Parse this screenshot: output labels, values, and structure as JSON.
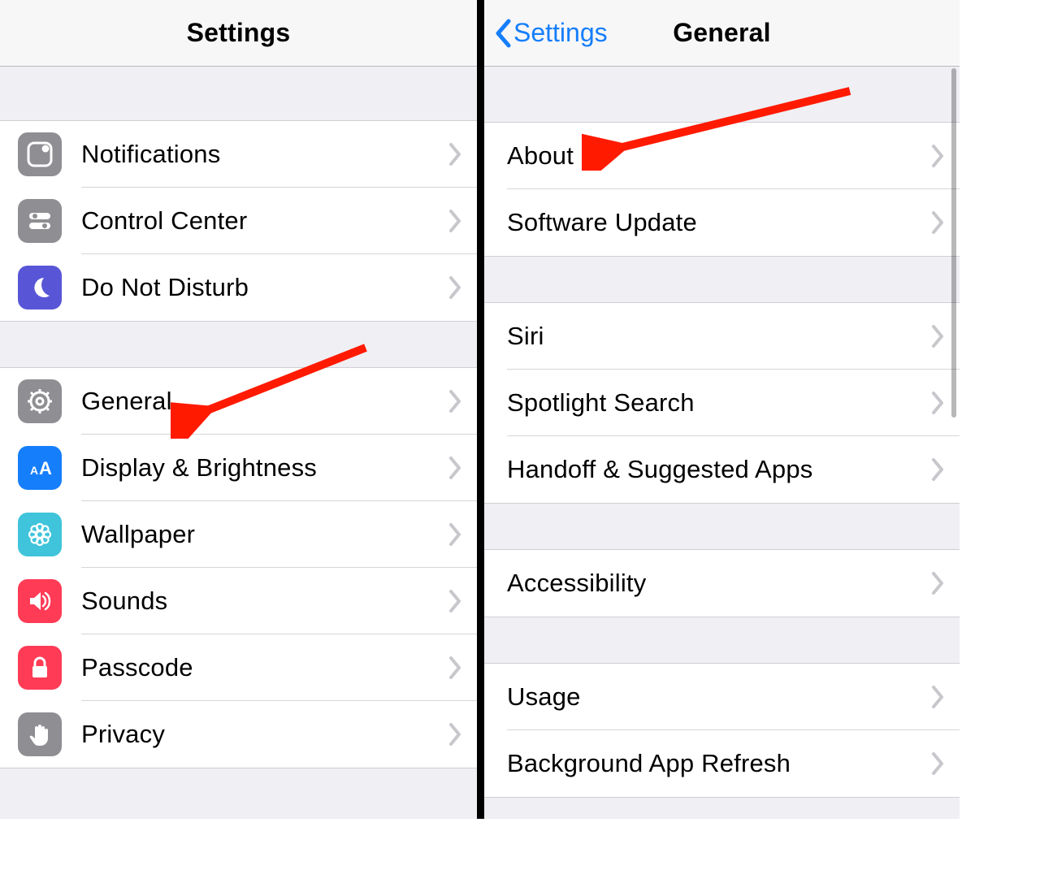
{
  "left": {
    "title": "Settings",
    "groups": [
      [
        {
          "id": "notifications",
          "label": "Notifications",
          "iconClass": "ic-notif",
          "iconName": "notifications-icon"
        },
        {
          "id": "control-center",
          "label": "Control Center",
          "iconClass": "ic-control",
          "iconName": "control-center-icon"
        },
        {
          "id": "dnd",
          "label": "Do Not Disturb",
          "iconClass": "ic-dnd",
          "iconName": "moon-icon"
        }
      ],
      [
        {
          "id": "general",
          "label": "General",
          "iconClass": "ic-general",
          "iconName": "gear-icon"
        },
        {
          "id": "display",
          "label": "Display & Brightness",
          "iconClass": "ic-display",
          "iconName": "text-size-icon"
        },
        {
          "id": "wallpaper",
          "label": "Wallpaper",
          "iconClass": "ic-wall",
          "iconName": "flower-icon"
        },
        {
          "id": "sounds",
          "label": "Sounds",
          "iconClass": "ic-sound",
          "iconName": "speaker-icon"
        },
        {
          "id": "passcode",
          "label": "Passcode",
          "iconClass": "ic-pass",
          "iconName": "lock-icon"
        },
        {
          "id": "privacy",
          "label": "Privacy",
          "iconClass": "ic-privacy",
          "iconName": "hand-icon"
        }
      ]
    ]
  },
  "right": {
    "backLabel": "Settings",
    "title": "General",
    "groups": [
      [
        {
          "id": "about",
          "label": "About"
        },
        {
          "id": "software",
          "label": "Software Update"
        }
      ],
      [
        {
          "id": "siri",
          "label": "Siri"
        },
        {
          "id": "spotlight",
          "label": "Spotlight Search"
        },
        {
          "id": "handoff",
          "label": "Handoff & Suggested Apps"
        }
      ],
      [
        {
          "id": "accessibility",
          "label": "Accessibility"
        }
      ],
      [
        {
          "id": "usage",
          "label": "Usage"
        },
        {
          "id": "bgrefresh",
          "label": "Background App Refresh"
        }
      ]
    ]
  },
  "annotations": {
    "arrow_targets": [
      "general",
      "about"
    ]
  }
}
